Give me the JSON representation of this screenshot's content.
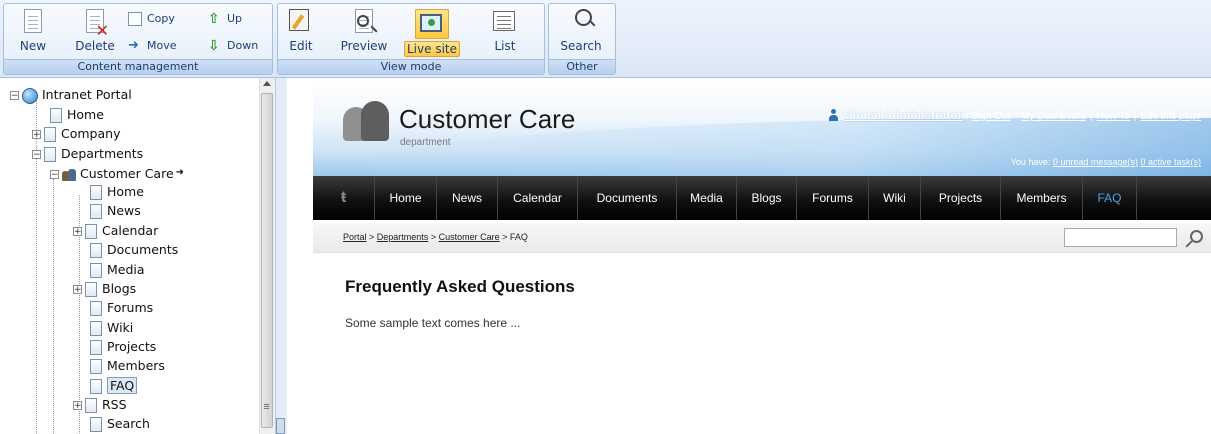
{
  "ribbon": {
    "content_group": {
      "caption": "Content management",
      "new_label": "New",
      "delete_label": "Delete",
      "copy_label": "Copy",
      "move_label": "Move",
      "up_label": "Up",
      "down_label": "Down"
    },
    "view_group": {
      "caption": "View mode",
      "edit_label": "Edit",
      "preview_label": "Preview",
      "live_site_label": "Live site",
      "list_label": "List",
      "active": "Live site"
    },
    "other_group": {
      "caption": "Other",
      "search_label": "Search"
    }
  },
  "tree": {
    "nodes": [
      {
        "label": "Intranet Portal"
      },
      {
        "label": "Home"
      },
      {
        "label": "Company"
      },
      {
        "label": "Departments"
      },
      {
        "label": "Customer Care"
      },
      {
        "label": "Home"
      },
      {
        "label": "News"
      },
      {
        "label": "Calendar"
      },
      {
        "label": "Documents"
      },
      {
        "label": "Media"
      },
      {
        "label": "Blogs"
      },
      {
        "label": "Forums"
      },
      {
        "label": "Wiki"
      },
      {
        "label": "Projects"
      },
      {
        "label": "Members"
      },
      {
        "label": "FAQ"
      },
      {
        "label": "RSS"
      },
      {
        "label": "Search"
      }
    ],
    "selected": "FAQ"
  },
  "site": {
    "title": "Customer Care",
    "subtitle": "department",
    "user": {
      "name": "Global Administrator",
      "separator": " : ",
      "links": [
        "Sign Out",
        "My Dashboard",
        "How To",
        "Edit this page"
      ]
    },
    "messages": {
      "prefix": "You have: ",
      "unread": "0 unread message(s)",
      "tasks": "0 active task(s)"
    },
    "menu": [
      "Home",
      "News",
      "Calendar",
      "Documents",
      "Media",
      "Blogs",
      "Forums",
      "Wiki",
      "Projects",
      "Members",
      "FAQ"
    ],
    "menu_active": "FAQ",
    "breadcrumb": {
      "items": [
        "Portal",
        "Departments",
        "Customer Care"
      ],
      "separator": " > ",
      "current": "FAQ"
    },
    "search_value": "",
    "heading": "Frequently Asked Questions",
    "body_text": "Some sample text comes here ..."
  },
  "colors": {
    "ribbon_accent": "#1c3f7a",
    "menu_active": "#4da3e8",
    "live_site_highlight": "#ffc940"
  }
}
